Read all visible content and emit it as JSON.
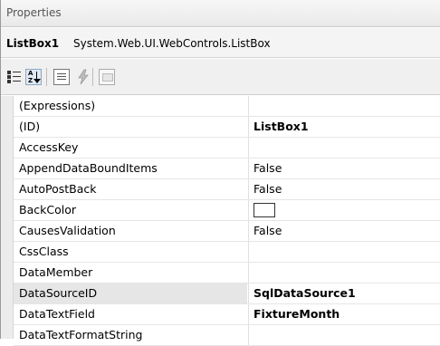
{
  "window": {
    "title": "Properties"
  },
  "object": {
    "name": "ListBox1",
    "type": "System.Web.UI.WebControls.ListBox"
  },
  "toolbar": {
    "categorized_icon": "categorized-icon",
    "alphabetical_icon": "alphabetical-icon",
    "properties_icon": "properties-icon",
    "events_icon": "events-lightning-icon",
    "property_pages_icon": "property-pages-icon"
  },
  "properties": [
    {
      "name": "(Expressions)",
      "value": ""
    },
    {
      "name": "(ID)",
      "value": "ListBox1",
      "bold": true
    },
    {
      "name": "AccessKey",
      "value": ""
    },
    {
      "name": "AppendDataBoundItems",
      "value": "False"
    },
    {
      "name": "AutoPostBack",
      "value": "False"
    },
    {
      "name": "BackColor",
      "value": "",
      "swatch": "#ffffff"
    },
    {
      "name": "CausesValidation",
      "value": "False"
    },
    {
      "name": "CssClass",
      "value": ""
    },
    {
      "name": "DataMember",
      "value": ""
    },
    {
      "name": "DataSourceID",
      "value": "SqlDataSource1",
      "bold": true,
      "selected": true
    },
    {
      "name": "DataTextField",
      "value": "FixtureMonth",
      "bold": true
    },
    {
      "name": "DataTextFormatString",
      "value": ""
    }
  ],
  "colors": {
    "selected_row": "#e6e6e6",
    "gutter": "#ececec"
  }
}
